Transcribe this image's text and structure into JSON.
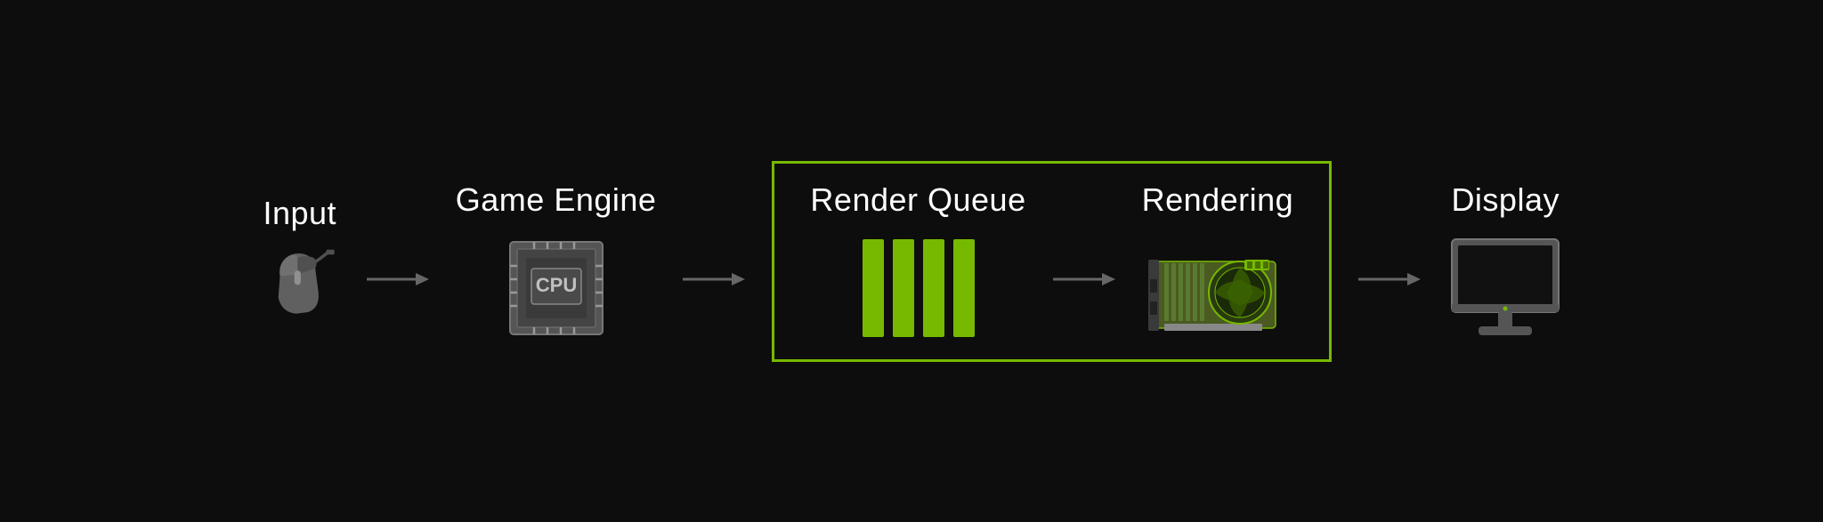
{
  "pipeline": {
    "stages": [
      {
        "id": "input",
        "label": "Input"
      },
      {
        "id": "game-engine",
        "label": "Game Engine"
      },
      {
        "id": "render-queue",
        "label": "Render Queue"
      },
      {
        "id": "rendering",
        "label": "Rendering"
      },
      {
        "id": "display",
        "label": "Display"
      }
    ],
    "colors": {
      "background": "#0d0d0d",
      "text": "#ffffff",
      "accent": "#76b900",
      "icon-gray": "#808080",
      "icon-dark-gray": "#606060"
    }
  }
}
